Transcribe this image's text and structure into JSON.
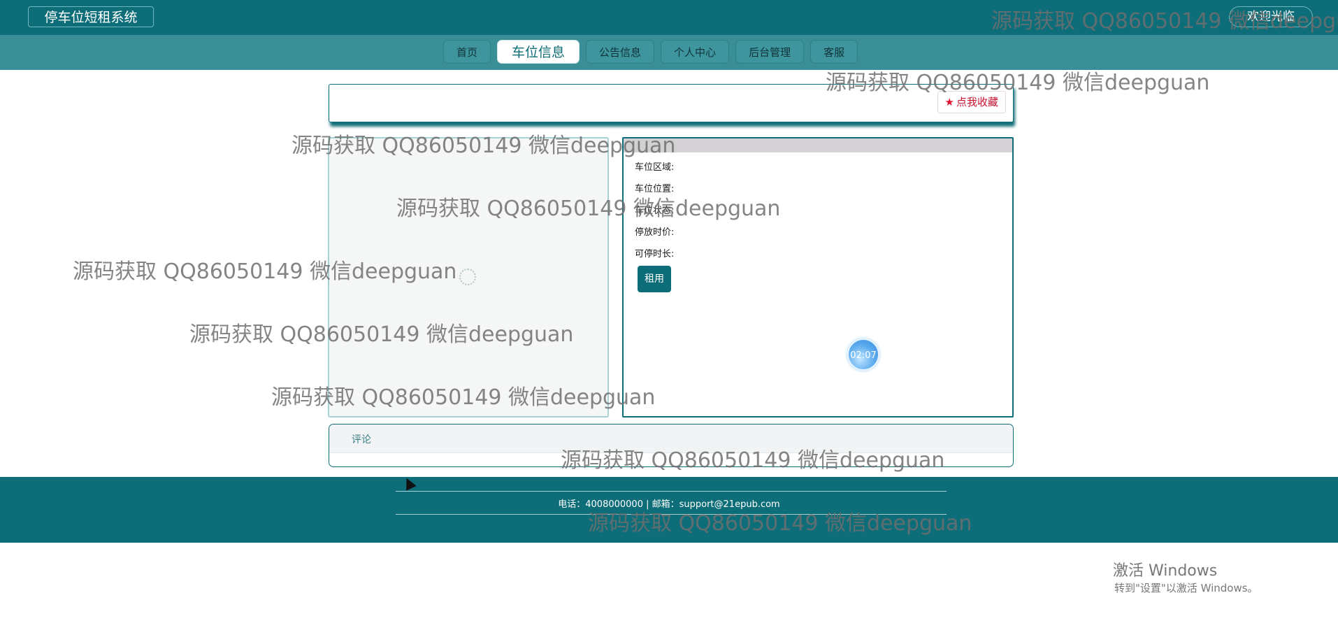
{
  "header": {
    "brand": "停车位短租系统",
    "welcome": "欢迎光临"
  },
  "nav": {
    "items": [
      "首页",
      "车位信息",
      "公告信息",
      "个人中心",
      "后台管理",
      "客服"
    ],
    "active_index": 1
  },
  "favorite": {
    "icon": "star-icon",
    "label": "点我收藏"
  },
  "detail": {
    "area_label": "车位区域:",
    "position_label": "车位位置:",
    "status_label": "车位状态:",
    "price_label": "停放时价:",
    "duration_label": "可停时长:",
    "rent_button": "租用",
    "timer_text": "02:07"
  },
  "comments": {
    "title": "评论"
  },
  "footer": {
    "contact": "电话：4008000000 | 邮箱：support@21epub.com"
  },
  "watermark": "源码获取 QQ86050149 微信deepguan",
  "os_overlay": {
    "title": "激活 Windows",
    "subtitle": "转到\"设置\"以激活 Windows。"
  },
  "colors": {
    "primary": "#0d6d78",
    "nav": "#3a8f97"
  }
}
